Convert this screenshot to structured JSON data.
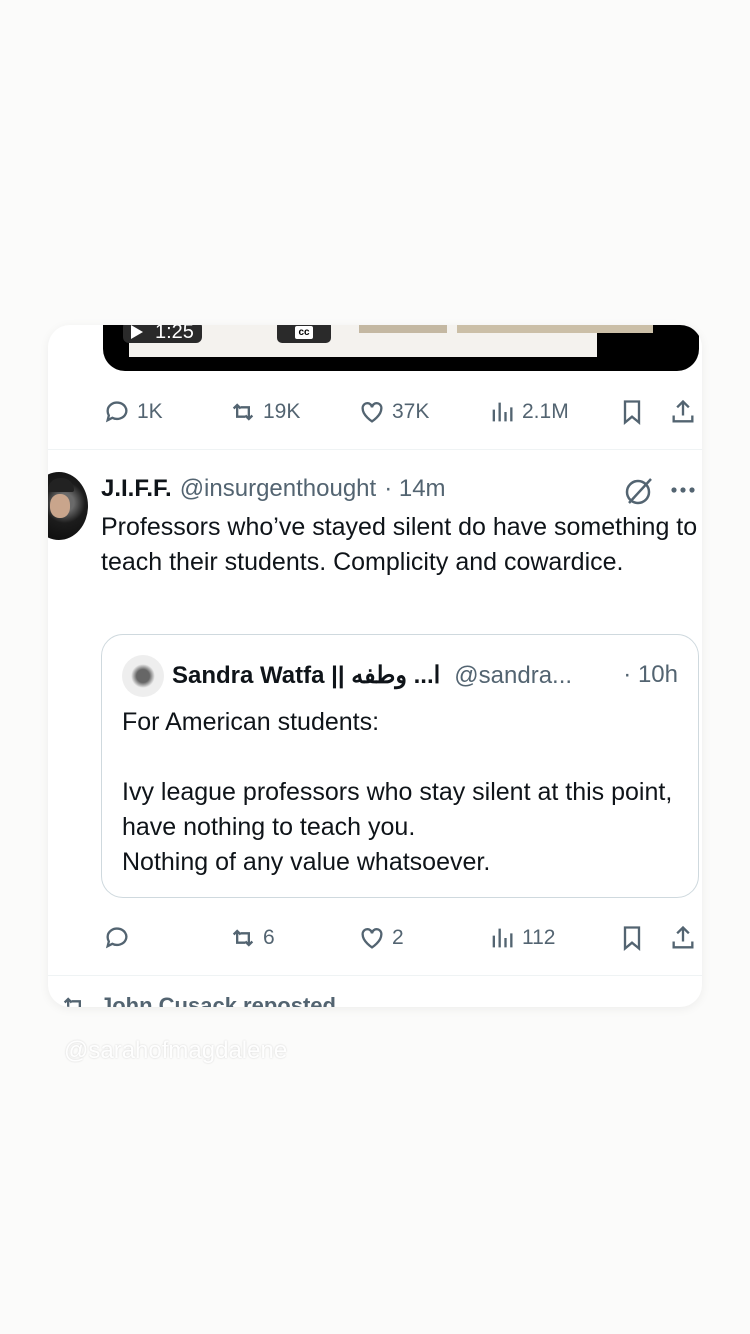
{
  "video": {
    "time": "1:25",
    "cc_label": "cc"
  },
  "post1_actions": {
    "replies": "1K",
    "reposts": "19K",
    "likes": "37K",
    "views": "2.1M"
  },
  "post2": {
    "author_name": "J.I.F.F.",
    "author_handle": "@insurgenthought",
    "time": "· 14m",
    "text": "Professors who’ve stayed silent do have something to teach their students. Complicity and cowardice.",
    "quote": {
      "author_name": "Sandra Watfa || ا... وطفه",
      "author_handle": "@sandra...",
      "time": "· 10h",
      "text": "For American students:\n\nIvy league professors who stay silent at this point, have nothing to teach you.\nNothing of any value whatsoever."
    },
    "actions": {
      "replies": "",
      "reposts": "6",
      "likes": "2",
      "views": "112"
    }
  },
  "repost_banner": "John Cusack reposted",
  "watermark": "@sarahofmagdalene",
  "icons": [
    "play-icon",
    "cc-icon",
    "expand-icon",
    "reply-icon",
    "repost-icon",
    "like-icon",
    "views-icon",
    "bookmark-icon",
    "share-icon",
    "grok-icon",
    "more-icon"
  ]
}
